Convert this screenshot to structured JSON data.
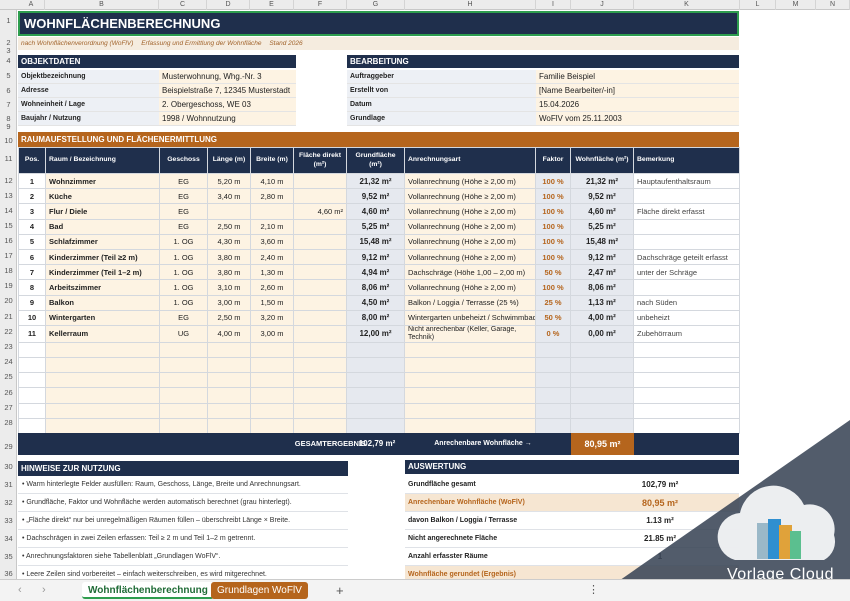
{
  "colheads": [
    "A",
    "B",
    "C",
    "D",
    "E",
    "F",
    "G",
    "H",
    "I",
    "J",
    "K",
    "L",
    "M",
    "N"
  ],
  "title": "WOHNFLÄCHENBERECHNUNG",
  "subtitle": {
    "a": "nach Wohnflächenverordnung (WoFlV)",
    "b": "Erfassung und Ermittlung der Wohnfläche",
    "c": "Stand 2026"
  },
  "objekt": {
    "header": "OBJEKTDATEN",
    "rows": [
      {
        "label": "Objektbezeichnung",
        "value": "Musterwohnung, Whg.-Nr. 3"
      },
      {
        "label": "Adresse",
        "value": "Beispielstraße 7, 12345 Musterstadt"
      },
      {
        "label": "Wohneinheit / Lage",
        "value": "2. Obergeschoss, WE 03"
      },
      {
        "label": "Baujahr / Nutzung",
        "value": "1998 / Wohnnutzung"
      }
    ]
  },
  "bearbeitung": {
    "header": "BEARBEITUNG",
    "rows": [
      {
        "label": "Auftraggeber",
        "value": "Familie Beispiel"
      },
      {
        "label": "Erstellt von",
        "value": "[Name Bearbeiter/-in]"
      },
      {
        "label": "Datum",
        "value": "15.04.2026"
      },
      {
        "label": "Grundlage",
        "value": "WoFlV vom 25.11.2003"
      }
    ]
  },
  "section_title": "RAUMAUFSTELLUNG UND FLÄCHENERMITTLUNG",
  "columns": [
    "Pos.",
    "Raum / Bezeichnung",
    "Geschoss",
    "Länge (m)",
    "Breite (m)",
    "Fläche direkt (m²)",
    "Grundfläche (m²)",
    "Anrechnungsart",
    "Faktor",
    "Wohnfläche (m²)",
    "Bemerkung"
  ],
  "rooms": [
    {
      "pos": "1",
      "raum": "Wohnzimmer",
      "gesch": "EG",
      "l": "5,20 m",
      "b": "4,10 m",
      "direkt": "",
      "grund": "21,32 m²",
      "art": "Vollanrechnung (Höhe ≥ 2,00 m)",
      "faktor": "100 %",
      "wohn": "21,32 m²",
      "bem": "Hauptaufenthaltsraum"
    },
    {
      "pos": "2",
      "raum": "Küche",
      "gesch": "EG",
      "l": "3,40 m",
      "b": "2,80 m",
      "direkt": "",
      "grund": "9,52 m²",
      "art": "Vollanrechnung (Höhe ≥ 2,00 m)",
      "faktor": "100 %",
      "wohn": "9,52 m²",
      "bem": ""
    },
    {
      "pos": "3",
      "raum": "Flur / Diele",
      "gesch": "EG",
      "l": "",
      "b": "",
      "direkt": "4,60 m²",
      "grund": "4,60 m²",
      "art": "Vollanrechnung (Höhe ≥ 2,00 m)",
      "faktor": "100 %",
      "wohn": "4,60 m²",
      "bem": "Fläche direkt erfasst"
    },
    {
      "pos": "4",
      "raum": "Bad",
      "gesch": "EG",
      "l": "2,50 m",
      "b": "2,10 m",
      "direkt": "",
      "grund": "5,25 m²",
      "art": "Vollanrechnung (Höhe ≥ 2,00 m)",
      "faktor": "100 %",
      "wohn": "5,25 m²",
      "bem": ""
    },
    {
      "pos": "5",
      "raum": "Schlafzimmer",
      "gesch": "1. OG",
      "l": "4,30 m",
      "b": "3,60 m",
      "direkt": "",
      "grund": "15,48 m²",
      "art": "Vollanrechnung (Höhe ≥ 2,00 m)",
      "faktor": "100 %",
      "wohn": "15,48 m²",
      "bem": ""
    },
    {
      "pos": "6",
      "raum": "Kinderzimmer (Teil ≥2 m)",
      "gesch": "1. OG",
      "l": "3,80 m",
      "b": "2,40 m",
      "direkt": "",
      "grund": "9,12 m²",
      "art": "Vollanrechnung (Höhe ≥ 2,00 m)",
      "faktor": "100 %",
      "wohn": "9,12 m²",
      "bem": "Dachschräge geteilt erfasst"
    },
    {
      "pos": "7",
      "raum": "Kinderzimmer (Teil 1–2 m)",
      "gesch": "1. OG",
      "l": "3,80 m",
      "b": "1,30 m",
      "direkt": "",
      "grund": "4,94 m²",
      "art": "Dachschräge (Höhe 1,00 – 2,00 m)",
      "faktor": "50 %",
      "wohn": "2,47 m²",
      "bem": "unter der Schräge"
    },
    {
      "pos": "8",
      "raum": "Arbeitszimmer",
      "gesch": "1. OG",
      "l": "3,10 m",
      "b": "2,60 m",
      "direkt": "",
      "grund": "8,06 m²",
      "art": "Vollanrechnung (Höhe ≥ 2,00 m)",
      "faktor": "100 %",
      "wohn": "8,06 m²",
      "bem": ""
    },
    {
      "pos": "9",
      "raum": "Balkon",
      "gesch": "1. OG",
      "l": "3,00 m",
      "b": "1,50 m",
      "direkt": "",
      "grund": "4,50 m²",
      "art": "Balkon / Loggia / Terrasse (25 %)",
      "faktor": "25 %",
      "wohn": "1,13 m²",
      "bem": "nach Süden"
    },
    {
      "pos": "10",
      "raum": "Wintergarten",
      "gesch": "EG",
      "l": "2,50 m",
      "b": "3,20 m",
      "direkt": "",
      "grund": "8,00 m²",
      "art": "Wintergarten unbeheizt / Schwimmbad",
      "faktor": "50 %",
      "wohn": "4,00 m²",
      "bem": "unbeheizt"
    },
    {
      "pos": "11",
      "raum": "Kellerraum",
      "gesch": "UG",
      "l": "4,00 m",
      "b": "3,00 m",
      "direkt": "",
      "grund": "12,00 m²",
      "art": "Nicht anrechenbar (Keller, Garage, Technik)",
      "faktor": "0 %",
      "wohn": "0,00 m²",
      "bem": "Zubehörraum"
    }
  ],
  "empty_rows": 6,
  "total": {
    "label": "GESAMTERGEBNIS",
    "grund": "102,79 m²",
    "anr_label": "Anrechenbare Wohnfläche →",
    "anr": "80,95 m²"
  },
  "hints": {
    "header": "HINWEISE ZUR NUTZUNG",
    "items": [
      "• Warm hinterlegte Felder ausfüllen: Raum, Geschoss, Länge, Breite und Anrechnungsart.",
      "• Grundfläche, Faktor und Wohnfläche werden automatisch berechnet (grau hinterlegt).",
      "• „Fläche direkt“ nur bei unregelmäßigen Räumen füllen – überschreibt Länge × Breite.",
      "• Dachschrägen in zwei Zeilen erfassen: Teil ≥ 2 m und Teil 1–2 m getrennt.",
      "• Anrechnungsfaktoren siehe Tabellenblatt „Grundlagen WoFlV“.",
      "• Leere Zeilen sind vorbereitet – einfach weiterschreiben, es wird mitgerechnet."
    ]
  },
  "auswertung": {
    "header": "AUSWERTUNG",
    "items": [
      {
        "label": "Grundfläche gesamt",
        "value": "102,79 m²"
      },
      {
        "label": "Anrechenbare Wohnfläche (WoFlV)",
        "value": "80,95 m²"
      },
      {
        "label": "davon Balkon / Loggia / Terrasse",
        "value": "1.13 m²"
      },
      {
        "label": "Nicht angerechnete Fläche",
        "value": "21.85 m²"
      },
      {
        "label": "Anzahl erfasster Räume",
        "value": "1"
      },
      {
        "label": "Wohnfläche gerundet (Ergebnis)",
        "value": ""
      }
    ]
  },
  "tabs": {
    "active": "Wohnflächenberechnung",
    "other": "Grundlagen WoFlV",
    "add": "+"
  },
  "watermark": "Vorlage Cloud"
}
